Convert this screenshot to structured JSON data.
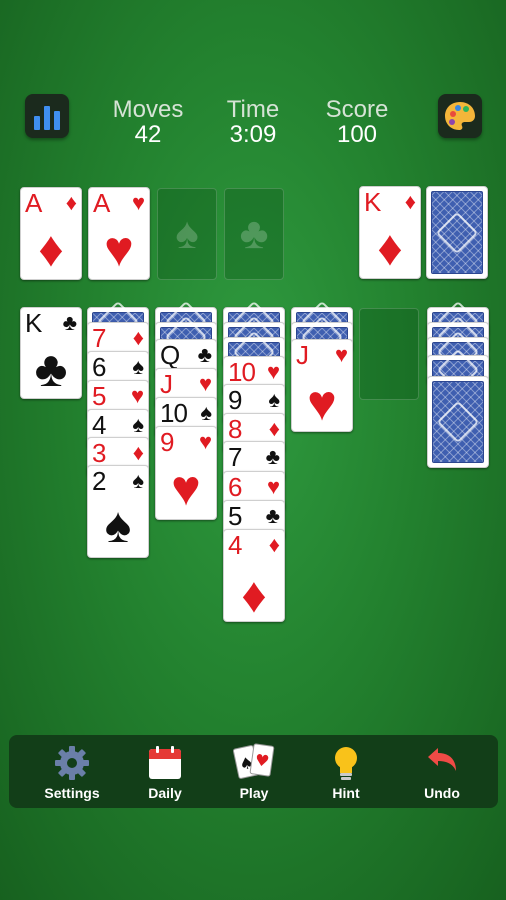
{
  "header": {
    "moves_label": "Moves",
    "moves_value": "42",
    "time_label": "Time",
    "time_value": "3:09",
    "score_label": "Score",
    "score_value": "100"
  },
  "foundations": [
    {
      "rank": "A",
      "suit": "♦",
      "color": "red"
    },
    {
      "rank": "A",
      "suit": "♥",
      "color": "red"
    },
    {
      "empty_suit": "♠"
    },
    {
      "empty_suit": "♣"
    }
  ],
  "waste": {
    "rank": "K",
    "suit": "♦",
    "color": "red"
  },
  "tableau": [
    {
      "cards": [
        {
          "rank": "K",
          "suit": "♣",
          "color": "black"
        }
      ]
    },
    {
      "cards": [
        {
          "rank": "7",
          "suit": "♦",
          "color": "red"
        },
        {
          "rank": "6",
          "suit": "♠",
          "color": "black"
        },
        {
          "rank": "5",
          "suit": "♥",
          "color": "red"
        },
        {
          "rank": "4",
          "suit": "♠",
          "color": "black"
        },
        {
          "rank": "3",
          "suit": "♦",
          "color": "red"
        },
        {
          "rank": "2",
          "suit": "♠",
          "color": "black"
        }
      ]
    },
    {
      "cards": [
        {
          "rank": "Q",
          "suit": "♣",
          "color": "black"
        },
        {
          "rank": "J",
          "suit": "♥",
          "color": "red"
        },
        {
          "rank": "10",
          "suit": "♠",
          "color": "black"
        },
        {
          "rank": "9",
          "suit": "♥",
          "color": "red"
        }
      ]
    },
    {
      "cards": [
        {
          "rank": "10",
          "suit": "♥",
          "color": "red"
        },
        {
          "rank": "9",
          "suit": "♠",
          "color": "black"
        },
        {
          "rank": "8",
          "suit": "♦",
          "color": "red"
        },
        {
          "rank": "7",
          "suit": "♣",
          "color": "black"
        },
        {
          "rank": "6",
          "suit": "♥",
          "color": "red"
        },
        {
          "rank": "5",
          "suit": "♣",
          "color": "black"
        },
        {
          "rank": "4",
          "suit": "♦",
          "color": "red"
        }
      ]
    },
    {
      "cards": [
        {
          "rank": "J",
          "suit": "♥",
          "color": "red"
        }
      ]
    },
    {
      "cards": []
    },
    {
      "cards": []
    }
  ],
  "toolbar": {
    "settings": "Settings",
    "daily": "Daily",
    "play": "Play",
    "hint": "Hint",
    "undo": "Undo"
  },
  "icons": {
    "stats": "bar-chart-icon",
    "theme": "palette-icon",
    "settings": "gear-icon",
    "daily": "calendar-icon",
    "play": "cards-icon",
    "hint": "lightbulb-icon",
    "undo": "undo-arrow-icon"
  }
}
